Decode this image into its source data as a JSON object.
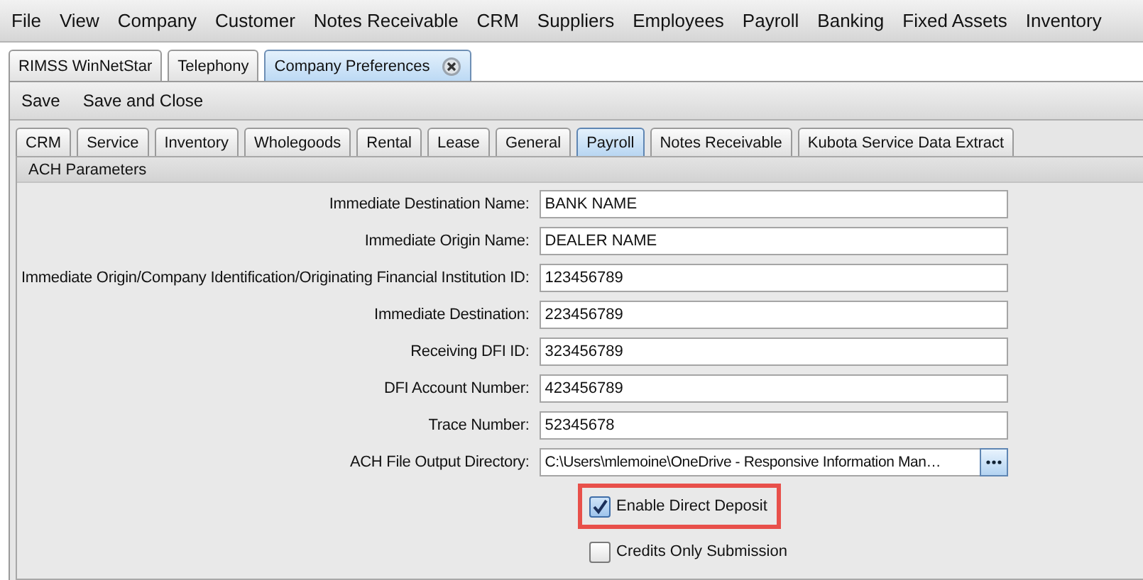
{
  "menu": [
    "File",
    "View",
    "Company",
    "Customer",
    "Notes Receivable",
    "CRM",
    "Suppliers",
    "Employees",
    "Payroll",
    "Banking",
    "Fixed Assets",
    "Inventory"
  ],
  "doc_tabs": [
    {
      "label": "RIMSS WinNetStar",
      "selected": false,
      "closable": false
    },
    {
      "label": "Telephony",
      "selected": false,
      "closable": false
    },
    {
      "label": "Company Preferences",
      "selected": true,
      "closable": true
    }
  ],
  "toolbar": [
    "Save",
    "Save and Close"
  ],
  "sub_tabs": [
    {
      "label": "CRM",
      "selected": false
    },
    {
      "label": "Service",
      "selected": false
    },
    {
      "label": "Inventory",
      "selected": false
    },
    {
      "label": "Wholegoods",
      "selected": false
    },
    {
      "label": "Rental",
      "selected": false
    },
    {
      "label": "Lease",
      "selected": false
    },
    {
      "label": "General",
      "selected": false
    },
    {
      "label": "Payroll",
      "selected": true
    },
    {
      "label": "Notes Receivable",
      "selected": false
    },
    {
      "label": "Kubota Service Data Extract",
      "selected": false
    }
  ],
  "section": {
    "title": "ACH Parameters",
    "fields": [
      {
        "kind": "text",
        "label": "Immediate Destination Name:",
        "value": "BANK NAME"
      },
      {
        "kind": "text",
        "label": "Immediate Origin Name:",
        "value": "DEALER NAME"
      },
      {
        "kind": "text",
        "label": "Immediate Origin/Company Identification/Originating Financial Institution ID:",
        "value": "123456789"
      },
      {
        "kind": "text",
        "label": "Immediate Destination:",
        "value": "223456789"
      },
      {
        "kind": "text",
        "label": "Receiving DFI ID:",
        "value": "323456789"
      },
      {
        "kind": "text",
        "label": "DFI Account Number:",
        "value": "423456789"
      },
      {
        "kind": "text",
        "label": "Trace Number:",
        "value": "52345678"
      },
      {
        "kind": "browse",
        "label": "ACH File Output Directory:",
        "value": "C:\\Users\\mlemoine\\OneDrive - Responsive Information Man…"
      }
    ],
    "checkboxes": [
      {
        "label": "Enable Direct Deposit",
        "checked": true,
        "highlighted": true
      },
      {
        "label": "Credits Only Submission",
        "checked": false,
        "highlighted": false
      }
    ]
  }
}
